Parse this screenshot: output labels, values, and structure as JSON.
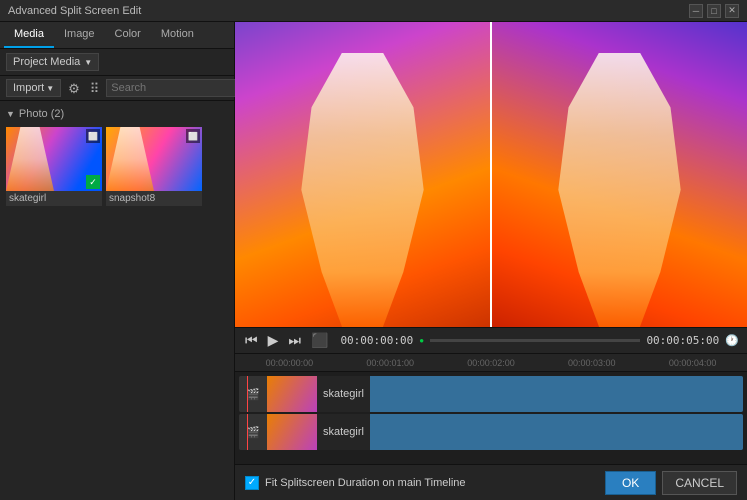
{
  "window": {
    "title": "Advanced Split Screen Edit",
    "controls": [
      "minimize",
      "maximize",
      "close"
    ]
  },
  "tabs": {
    "items": [
      "Media",
      "Image",
      "Color",
      "Motion"
    ],
    "active": 0
  },
  "toolbar": {
    "dropdown_label": "Project Media",
    "import_label": "Import",
    "search_placeholder": "Search"
  },
  "media_panel": {
    "section_label": "Photo (2)",
    "items": [
      {
        "name": "skategirl",
        "has_check": true
      },
      {
        "name": "snapshot8",
        "has_check": false
      }
    ]
  },
  "transport": {
    "time_current": "00:00:00:00",
    "time_end": "00:00:05:00"
  },
  "timeline": {
    "ruler_marks": [
      "00:00:00:00",
      "00:00:01:00",
      "00:00:02:00",
      "00:00:03:00",
      "00:00:04:00",
      ""
    ],
    "tracks": [
      {
        "label": "skategirl"
      },
      {
        "label": "skategirl"
      }
    ]
  },
  "bottom": {
    "checkbox_label": "Fit Splitscreen Duration on main Timeline",
    "ok_label": "OK",
    "cancel_label": "CANCEL"
  }
}
